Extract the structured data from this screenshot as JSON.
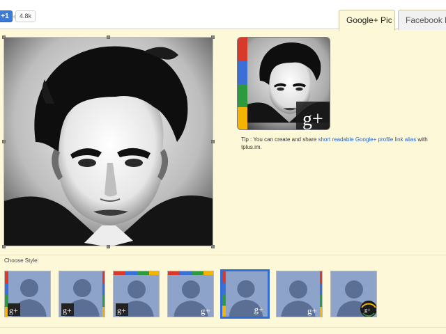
{
  "social": {
    "plusone_label": "+1",
    "count": "4.8k"
  },
  "tabs": [
    {
      "label": "Google+ Pic",
      "active": true
    },
    {
      "label": "Facebook P",
      "active": false
    }
  ],
  "tip": {
    "prefix": "Tip : You can create and share ",
    "link": "short readable Google+ profile link alias",
    "suffix": " with Iplus.im."
  },
  "styles": {
    "label": "Choose Style:",
    "selected_index": 4
  },
  "badge": {
    "text": "g+"
  },
  "colors": {
    "google_red": "#d7392b",
    "google_yellow": "#f6b400",
    "google_green": "#2e9a40",
    "google_blue": "#3b6fd8",
    "page_bg": "#fdf8d8",
    "selected_border": "#2e6cdb",
    "link": "#2266cc"
  },
  "icons": [
    "plusone-icon",
    "google-plus-badge-icon",
    "crop-handle-icon",
    "avatar-silhouette-icon"
  ]
}
